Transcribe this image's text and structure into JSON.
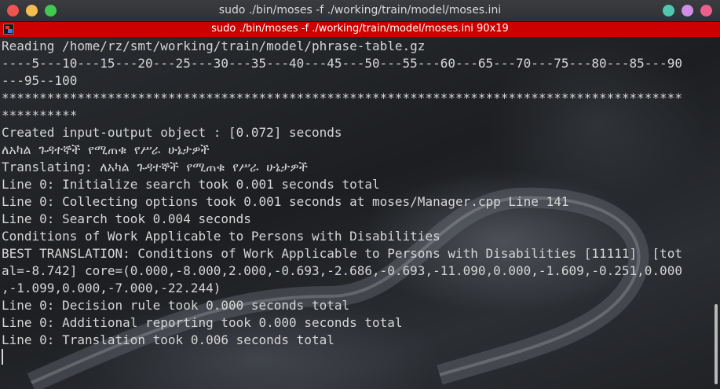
{
  "window": {
    "title": "sudo ./bin/moses -f ./working/train/model/moses.ini"
  },
  "tab": {
    "title": "sudo ./bin/moses -f ./working/train/model/moses.ini 90x19"
  },
  "terminal": {
    "lines": [
      "Reading /home/rz/smt/working/train/model/phrase-table.gz",
      "----5---10---15---20---25---30---35---40---45---50---55---60---65---70---75---80---85---90",
      "---95--100",
      "******************************************************************************************",
      "**********",
      "Created input-output object : [0.072] seconds",
      "ለአካል ጉዳተኞች የሚጠቁ የሥራ ሁኔታዎች",
      "Translating: ለአካል ጉዳተኞች የሚጠቁ የሥራ ሁኔታዎች",
      "Line 0: Initialize search took 0.001 seconds total",
      "Line 0: Collecting options took 0.001 seconds at moses/Manager.cpp Line 141",
      "Line 0: Search took 0.004 seconds",
      "Conditions of Work Applicable to Persons with Disabilities",
      "BEST TRANSLATION: Conditions of Work Applicable to Persons with Disabilities [11111]  [tot",
      "al=-8.742] core=(0.000,-8.000,2.000,-0.693,-2.686,-0.693,-11.090,0.000,-1.609,-0.251,0.000",
      ",-1.099,0.000,-7.000,-22.244)",
      "Line 0: Decision rule took 0.000 seconds total",
      "Line 0: Additional reporting took 0.000 seconds total",
      "Line 0: Translation took 0.006 seconds total"
    ]
  },
  "colors": {
    "tab_active": "#cc0000",
    "text": "#d6d6d6",
    "close": "#f0544f",
    "minimize": "#f5bd4f",
    "maximize": "#3fc950"
  }
}
